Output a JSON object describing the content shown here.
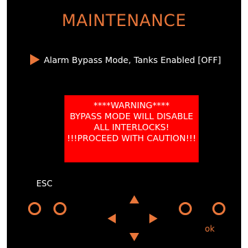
{
  "screen": {
    "title": "MAINTENANCE",
    "bypass_item": "Alarm Bypass Mode, Tanks Enabled [OFF]",
    "warning_lines": [
      "****WARNING****",
      "BYPASS MODE WILL DISABLE",
      "ALL INTERLOCKS!",
      "!!!PROCEED WITH CAUTION!!!"
    ]
  },
  "controls": {
    "esc_label": "ESC",
    "ok_label": "ok"
  },
  "colors": {
    "accent": "#e8763a",
    "warning_bg": "#ff0000",
    "background": "#000000",
    "text": "#ffffff"
  },
  "icons": [
    "arrow-right-icon",
    "arrow-up-icon",
    "arrow-down-icon",
    "arrow-left-icon"
  ]
}
